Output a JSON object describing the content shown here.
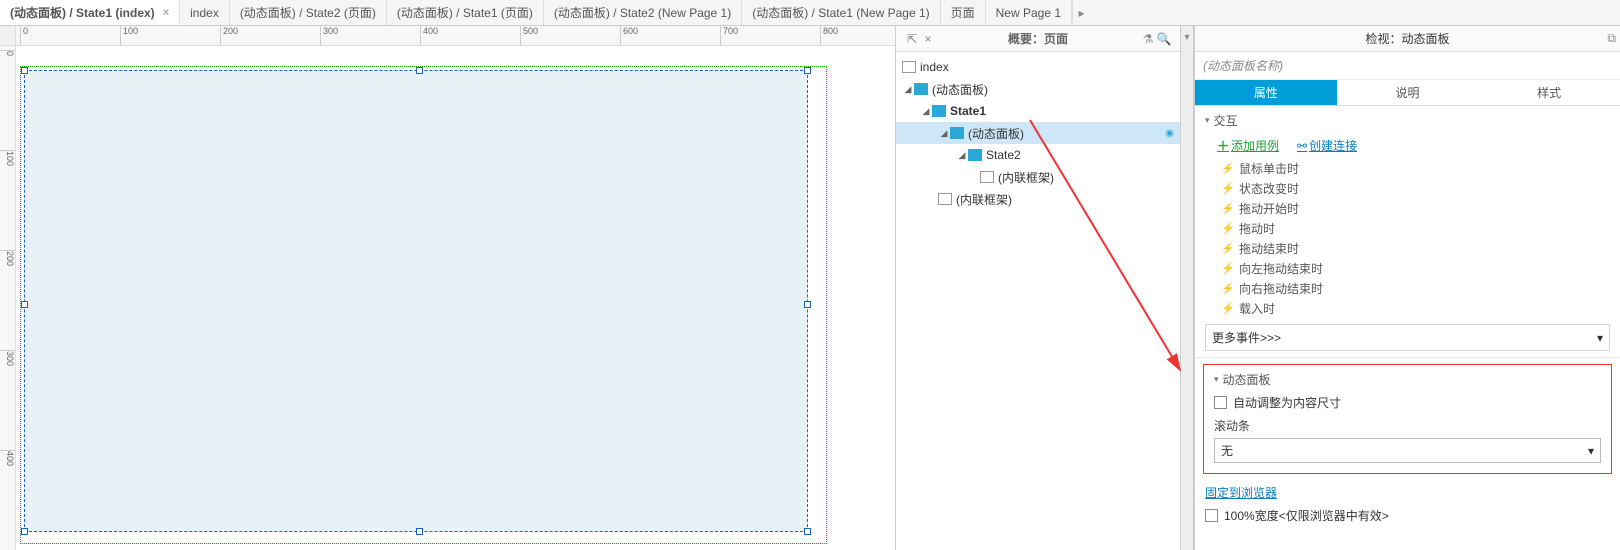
{
  "tabs": [
    {
      "label": "(动态面板) / State1 (index)",
      "active": true
    },
    {
      "label": "index"
    },
    {
      "label": "(动态面板) / State2 (页面)"
    },
    {
      "label": "(动态面板) / State1 (页面)"
    },
    {
      "label": "(动态面板) / State2 (New Page 1)"
    },
    {
      "label": "(动态面板) / State1 (New Page 1)"
    },
    {
      "label": "页面"
    },
    {
      "label": "New Page 1"
    }
  ],
  "ruler_h": [
    0,
    100,
    200,
    300,
    400,
    500,
    600,
    700,
    800
  ],
  "ruler_v": [
    0,
    100,
    200,
    300,
    400
  ],
  "outline": {
    "title": "概要：页面",
    "tree": {
      "page": "index",
      "dp1": "(动态面板)",
      "state1": "State1",
      "dp2": "(动态面板)",
      "state2": "State2",
      "frame1": "(内联框架)",
      "frame2": "(内联框架)"
    }
  },
  "props": {
    "header": "检视：动态面板",
    "name_placeholder": "(动态面板名称)",
    "tabs": {
      "attr": "属性",
      "notes": "说明",
      "style": "样式"
    },
    "interaction_title": "交互",
    "add_case": "添加用例",
    "create_link": "创建连接",
    "events": [
      "鼠标单击时",
      "状态改变时",
      "拖动开始时",
      "拖动时",
      "拖动结束时",
      "向左拖动结束时",
      "向右拖动结束时",
      "载入时"
    ],
    "more_events": "更多事件>>>",
    "dp_section": "动态面板",
    "auto_fit": "自动调整为内容尺寸",
    "scrollbar_label": "滚动条",
    "scrollbar_value": "无",
    "pin": "固定到浏览器",
    "width100": "100%宽度<仅限浏览器中有效>"
  }
}
